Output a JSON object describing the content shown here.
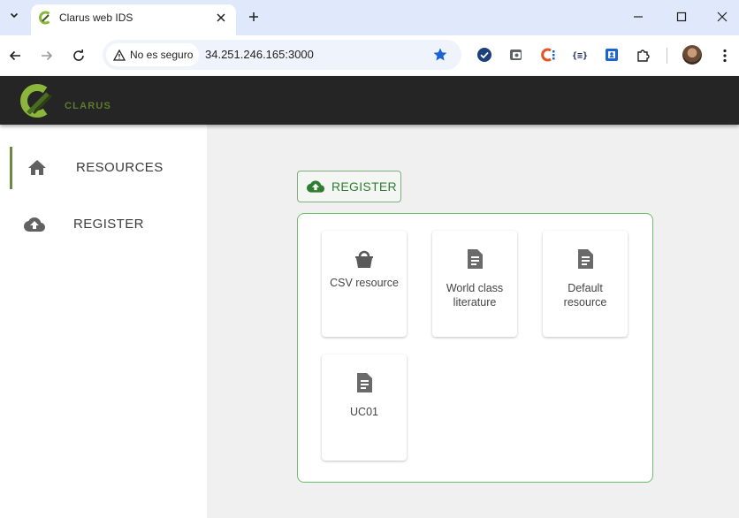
{
  "browser": {
    "tab_title": "Clarus web IDS",
    "security_label": "No es seguro",
    "url": "34.251.246.165:3000"
  },
  "app": {
    "logo_text": "CLARUS",
    "brand_color": "#6d8a44"
  },
  "sidebar": {
    "items": [
      {
        "label": "RESOURCES",
        "icon": "home-icon",
        "active": true
      },
      {
        "label": "REGISTER",
        "icon": "cloud-upload-icon",
        "active": false
      }
    ]
  },
  "main": {
    "register_button_label": "REGISTER",
    "resources": [
      {
        "label": "CSV resource",
        "icon": "basket-icon"
      },
      {
        "label": "World class literature",
        "icon": "document-icon"
      },
      {
        "label": "Default resource",
        "icon": "document-icon"
      },
      {
        "label": "UC01",
        "icon": "document-icon"
      }
    ]
  }
}
